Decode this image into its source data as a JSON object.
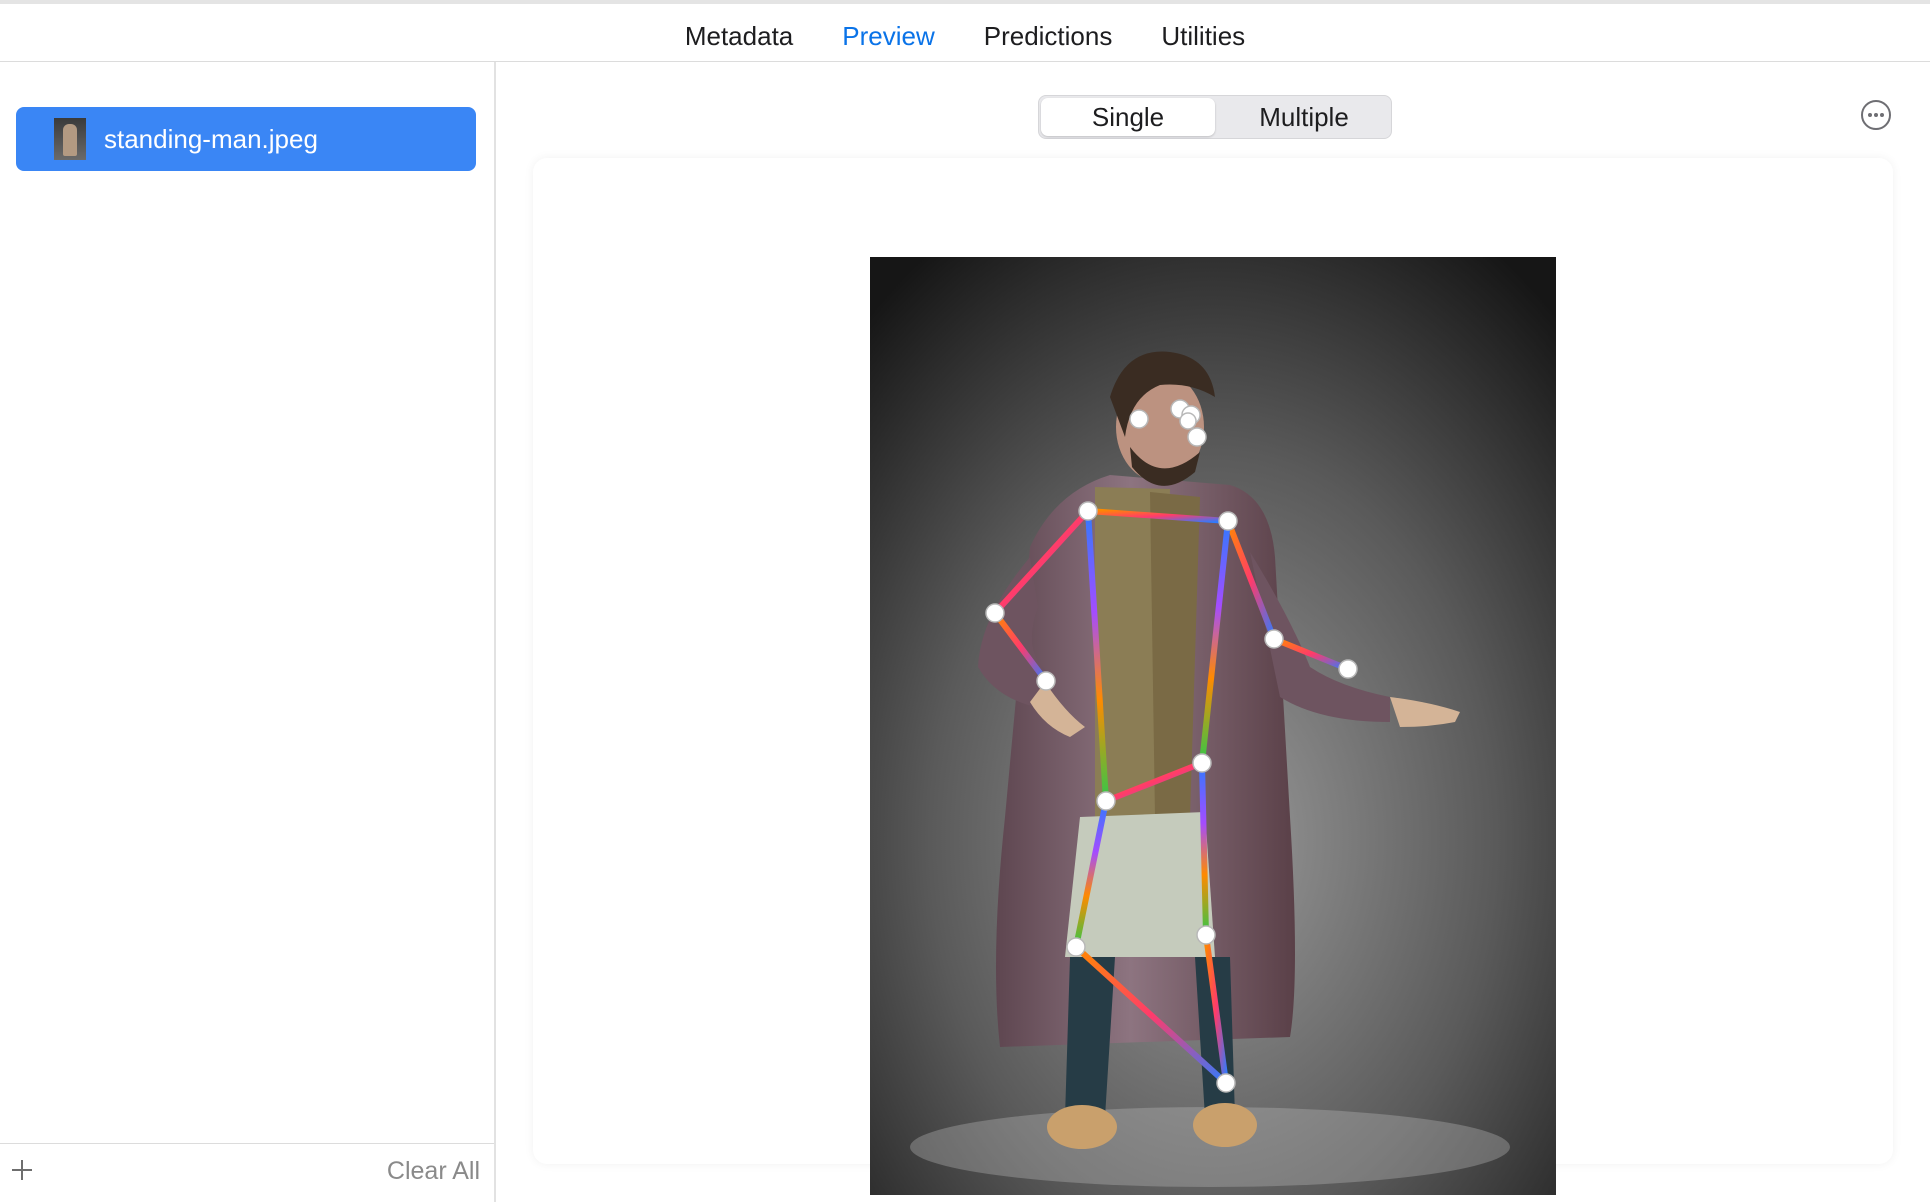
{
  "tabs": [
    {
      "label": "Metadata",
      "active": false
    },
    {
      "label": "Preview",
      "active": true
    },
    {
      "label": "Predictions",
      "active": false
    },
    {
      "label": "Utilities",
      "active": false
    }
  ],
  "sidebar": {
    "files": [
      {
        "name": "standing-man.jpeg",
        "selected": true
      }
    ],
    "add_icon": "plus-icon",
    "clear_all_label": "Clear All"
  },
  "main": {
    "mode_options": [
      {
        "label": "Single",
        "active": true
      },
      {
        "label": "Multiple",
        "active": false
      }
    ],
    "more_icon": "ellipsis-circle-icon"
  },
  "colors": {
    "accent": "#0a73e8",
    "selection": "#3a86f5"
  }
}
